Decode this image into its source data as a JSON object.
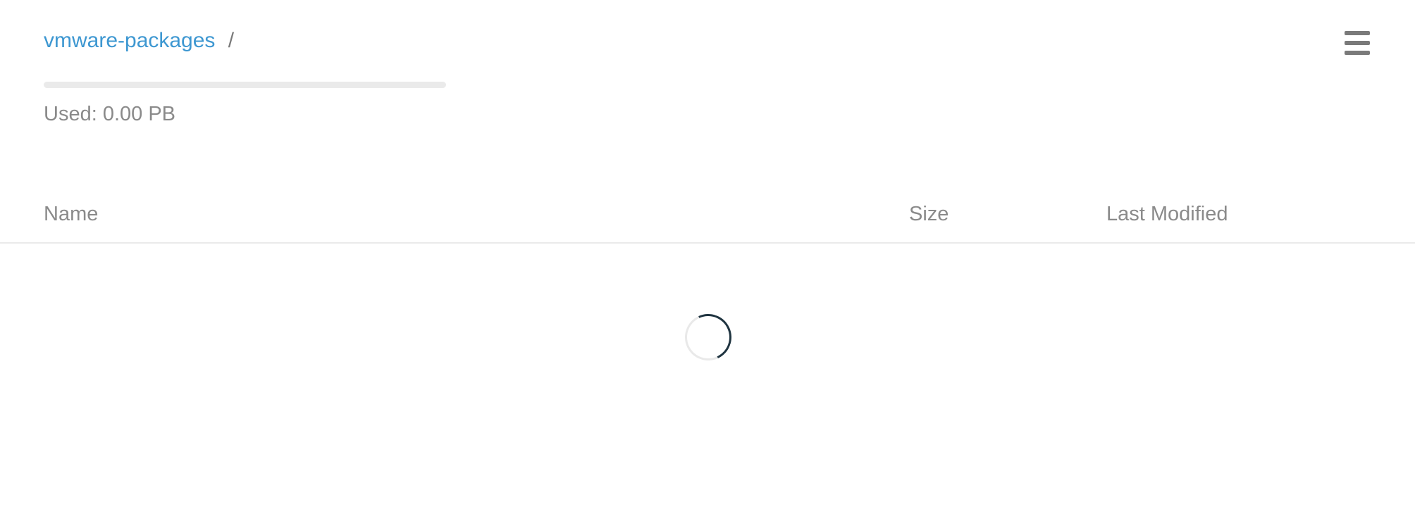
{
  "breadcrumb": {
    "bucket": "vmware-packages",
    "separator": "/"
  },
  "menu": {
    "icon": "hamburger-menu-icon"
  },
  "usage": {
    "label": "Used: 0.00 PB",
    "fraction": 0.0,
    "fill_color": "#3d97d1"
  },
  "table": {
    "columns": {
      "name": "Name",
      "size": "Size",
      "last_modified": "Last Modified"
    }
  },
  "loading": {
    "icon": "loading-spinner-icon"
  },
  "colors": {
    "link": "#3d97d1",
    "text": "#7a7a7a",
    "divider": "#eaeaea",
    "spinner": "#1f3440"
  }
}
